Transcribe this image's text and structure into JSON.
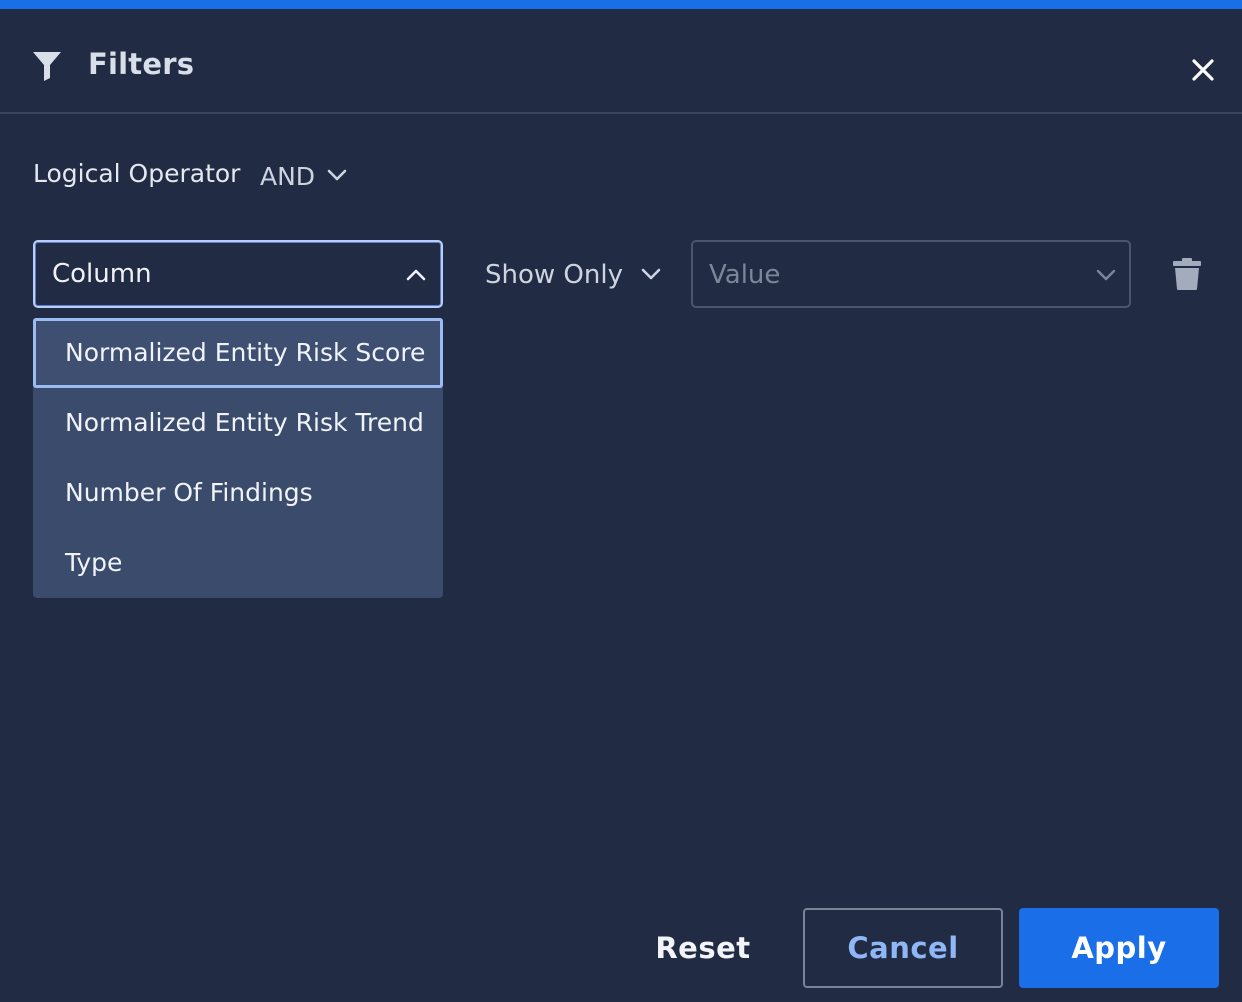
{
  "header": {
    "title": "Filters",
    "icon": "filter-icon",
    "close_icon": "close-icon"
  },
  "logical_operator": {
    "label": "Logical Operator",
    "value": "AND"
  },
  "filter_row": {
    "column": {
      "label": "Column",
      "expanded": true,
      "options": [
        "Normalized Entity Risk Score",
        "Normalized Entity Risk Trend",
        "Number Of Findings",
        "Type"
      ],
      "highlighted_index": 0
    },
    "condition": {
      "value": "Show Only"
    },
    "value": {
      "placeholder": "Value"
    },
    "delete_icon": "trash-icon"
  },
  "footer": {
    "reset_label": "Reset",
    "cancel_label": "Cancel",
    "apply_label": "Apply"
  },
  "colors": {
    "background": "#212b43",
    "accent": "#1a6ee8",
    "dropdown_bg": "#3b4b6c",
    "focus_border": "#b9cdfb"
  }
}
